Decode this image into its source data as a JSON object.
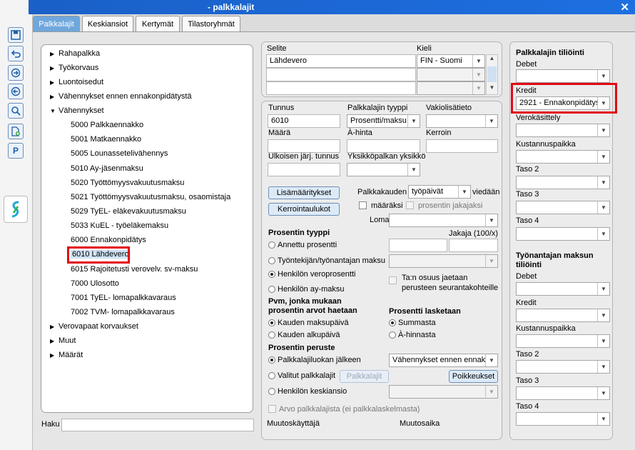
{
  "window": {
    "title": "- palkkalajit",
    "close": "✕"
  },
  "tabs": [
    "Palkkalajit",
    "Keskiansiot",
    "Kertymät",
    "Tilastoryhmät"
  ],
  "toolbar": {
    "p_label": "P"
  },
  "tree": {
    "groups": [
      "Rahapalkka",
      "Työkorvaus",
      "Luontoisedut",
      "Vähennykset ennen ennakonpidätystä",
      "Vähennykset",
      "Verovapaat korvaukset",
      "Muut",
      "Määrät"
    ],
    "children": [
      "5000 Palkkaennakko",
      "5001 Matkaennakko",
      "5005 Lounasseteliväh ennys",
      "5010 Ay-jäsenmaksu",
      "5020 Työttömyysvakuutusmaksu",
      "5021 Työttömyysvakuutusmaksu, osaomistaja",
      "5029 TyEL- eläkevakuutusmaksu",
      "5033 KuEL - työeläkemaksu",
      "6000 Ennakonpidätys",
      "6010 Lähdevero",
      "6015 Rajoitetusti verovelv. sv-maksu",
      "7000 Ulosotto",
      "7001 TyEL- lomapalkkavaraus",
      "7002 TVM- lomapalkkavaraus"
    ],
    "selected": "6010 Lähdevero"
  },
  "search": {
    "label": "Haku",
    "value": ""
  },
  "description": {
    "selite_label": "Selite",
    "kieli_label": "Kieli",
    "selite_value": "Lähdevero",
    "kieli_value": "FIN - Suomi"
  },
  "form": {
    "tunnus_label": "Tunnus",
    "tunnus_value": "6010",
    "tyyppi_label": "Palkkalajin tyyppi",
    "tyyppi_value": "Prosentti/maksu",
    "vakio_label": "Vakiolisätieto",
    "vakio_value": "",
    "maara_label": "Määrä",
    "ahinta_label": "À-hinta",
    "kerroin_label": "Kerroin",
    "ulk_label": "Ulkoisen järj. tunnus",
    "yksikko_label": "Yksikköpalkan yksikkö",
    "lisamaaritykset_btn": "Lisämääritykset",
    "kerrointaulukot_btn": "Kerrointaulukot",
    "palkkakauden_label": "Palkkakauden",
    "palkkakauden_value": "työpäivät",
    "viedaan_label": "viedään",
    "maaraksi_label": "määräksi",
    "prosentin_jakajaksi_label": "prosentin jakajaksi",
    "loma_label": "Loma",
    "prosentin_tyyppi_label": "Prosentin tyyppi",
    "jakaja_label": "Jakaja (100/x)",
    "radio_annettu": "Annettu prosentti",
    "radio_tyontekija": "Työntekijän/työnantajan maksu",
    "radio_veroprosentti": "Henkilön veroprosentti",
    "radio_ay": "Henkilön ay-maksu",
    "tan_osuus_label": "Ta:n osuus jaetaan perusteen seurantakohteille",
    "pvm_label": "Pvm, jonka mukaan prosentin arvot haetaan",
    "radio_maksupaiva": "Kauden maksupäivä",
    "radio_alkupaiva": "Kauden alkupäivä",
    "prosentti_lasketaan_label": "Prosentti lasketaan",
    "radio_summasta": "Summasta",
    "radio_ahinnasta": "À-hinnasta",
    "peruste_label": "Prosentin peruste",
    "radio_jalkeen": "Palkkalajiluokan jälkeen",
    "peruste_value": "Vähennykset ennen ennako",
    "radio_valitut": "Valitut palkkalajit",
    "palkkalajit_btn": "Palkkalajit",
    "poikkeukset_btn": "Poikkeukset",
    "radio_keskiansio": "Henkilön keskiansio",
    "arvo_label": "Arvo palkkalajista (ei palkkalaskelmasta)",
    "muutoskayttaja_label": "Muutoskäyttäjä",
    "muutosaika_label": "Muutosaika"
  },
  "accounts": {
    "title": "Palkkalajin tiliöinti",
    "debet_label": "Debet",
    "kredit_label": "Kredit",
    "kredit_value": "2921 - Ennakonpidätys",
    "verokasittely_label": "Verokäsittely",
    "kustannuspaikka_label": "Kustannuspaikka",
    "taso2_label": "Taso 2",
    "taso3_label": "Taso 3",
    "taso4_label": "Taso 4",
    "employer_title": "Työnantajan maksun tiliöinti",
    "e_debet_label": "Debet",
    "e_kredit_label": "Kredit",
    "e_kustannuspaikka_label": "Kustannuspaikka",
    "e_taso2_label": "Taso 2",
    "e_taso3_label": "Taso 3",
    "e_taso4_label": "Taso 4"
  },
  "colors": {
    "accent": "#6fa7dc",
    "highlight": "#e30613",
    "titlebar": "#1d6fe0"
  }
}
